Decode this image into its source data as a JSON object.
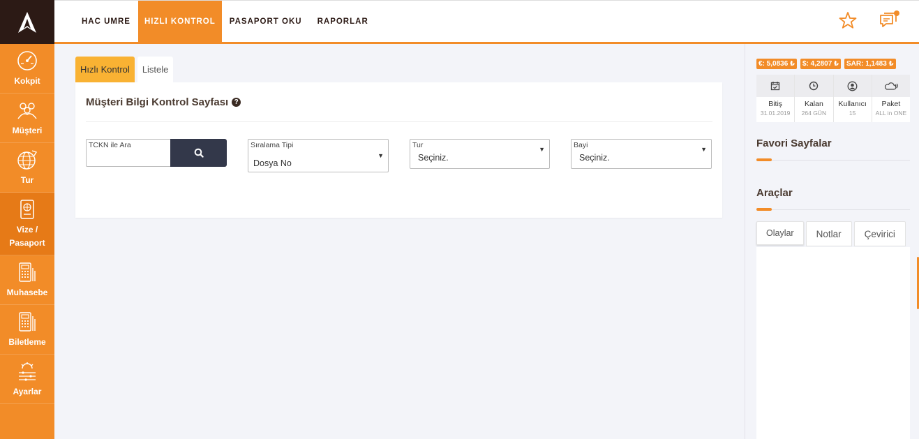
{
  "sidebar": {
    "items": [
      {
        "label": "Kokpit",
        "icon": "speedometer-icon"
      },
      {
        "label": "Müşteri",
        "icon": "customers-icon"
      },
      {
        "label": "Tur",
        "icon": "globe-plane-icon"
      },
      {
        "label": "Vize /\nPasaport",
        "icon": "passport-icon"
      },
      {
        "label": "Muhasebe",
        "icon": "calculator-icon"
      },
      {
        "label": "Biletleme",
        "icon": "ticket-calculator-icon"
      },
      {
        "label": "Ayarlar",
        "icon": "settings-sliders-icon"
      }
    ]
  },
  "topbar": {
    "menu": [
      "HAC UMRE",
      "HIZLI KONTROL",
      "PASAPORT OKU",
      "RAPORLAR"
    ],
    "icons": [
      "star-icon",
      "messages-icon"
    ]
  },
  "main": {
    "tabs": [
      "Hızlı Kontrol",
      "Listele"
    ],
    "title": "Müşteri Bilgi Kontrol Sayfası",
    "tckn": {
      "label": "TCKN ile Ara",
      "value": ""
    },
    "siralama": {
      "label": "Sıralama Tipi",
      "value": "Dosya No"
    },
    "tur": {
      "label": "Tur",
      "value": "Seçiniz."
    },
    "bayi": {
      "label": "Bayi",
      "value": "Seçiniz."
    }
  },
  "right": {
    "currencies": [
      "€: 5,0836 ₺",
      "$: 4,2807 ₺",
      "SAR: 1,1483 ₺"
    ],
    "stats": [
      {
        "label": "Bitiş",
        "value": "31.01.2019",
        "icon": "calendar-icon"
      },
      {
        "label": "Kalan",
        "value": "264 GÜN",
        "icon": "clock-icon"
      },
      {
        "label": "Kullanıcı",
        "value": "15",
        "icon": "user-icon"
      },
      {
        "label": "Paket",
        "value": "ALL in ONE",
        "icon": "cloud-icon"
      }
    ],
    "favorites_title": "Favori Sayfalar",
    "tools_title": "Araçlar",
    "tabs": [
      "Olaylar",
      "Notlar",
      "Çevirici"
    ]
  },
  "colors": {
    "accent": "#f28c28",
    "dark": "#2c1a15",
    "tab_active": "#f9b233"
  }
}
